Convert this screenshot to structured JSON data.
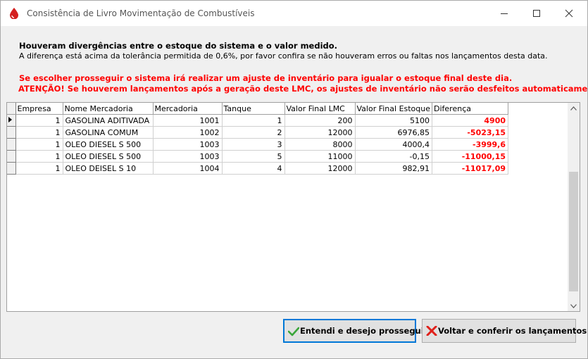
{
  "window": {
    "title": "Consistência de Livro Movimentação de Combustíveis",
    "app_icon": "fuel-drop-icon"
  },
  "messages": {
    "heading": "Houveram divergências entre o estoque do sistema e o valor medido.",
    "detail": "A diferença está acima da tolerância permitida de 0,6%, por favor confira se não houveram erros ou faltas nos lançamentos desta data.",
    "warning1": "Se escolher prosseguir o sistema irá realizar um ajuste de inventário para igualar o estoque final deste dia.",
    "warning2": "ATENÇÃO! Se houverem lançamentos após a geração deste LMC, os ajustes de inventário não serão desfeitos automaticamente."
  },
  "grid": {
    "columns": [
      "Empresa",
      "Nome Mercadoria",
      "Mercadoria",
      "Tanque",
      "Valor Final LMC",
      "Valor Final Estoque",
      "Diferença"
    ],
    "rows": [
      {
        "empresa": "1",
        "nome": "GASOLINA ADITIVADA",
        "mercadoria": "1001",
        "tanque": "1",
        "lmc": "200",
        "estoque": "5100",
        "diferenca": "4900"
      },
      {
        "empresa": "1",
        "nome": "GASOLINA COMUM",
        "mercadoria": "1002",
        "tanque": "2",
        "lmc": "12000",
        "estoque": "6976,85",
        "diferenca": "-5023,15"
      },
      {
        "empresa": "1",
        "nome": "OLEO DIESEL  S 500",
        "mercadoria": "1003",
        "tanque": "3",
        "lmc": "8000",
        "estoque": "4000,4",
        "diferenca": "-3999,6"
      },
      {
        "empresa": "1",
        "nome": "OLEO DIESEL  S 500",
        "mercadoria": "1003",
        "tanque": "5",
        "lmc": "11000",
        "estoque": "-0,15",
        "diferenca": "-11000,15"
      },
      {
        "empresa": "1",
        "nome": "OLEO DEISEL S 10",
        "mercadoria": "1004",
        "tanque": "4",
        "lmc": "12000",
        "estoque": "982,91",
        "diferenca": "-11017,09"
      }
    ]
  },
  "buttons": {
    "proceed": "Entendi e desejo prosseguir",
    "back": "Voltar e conferir os lançamentos"
  },
  "colors": {
    "warning": "#ff0000",
    "focus_border": "#0078d7"
  }
}
